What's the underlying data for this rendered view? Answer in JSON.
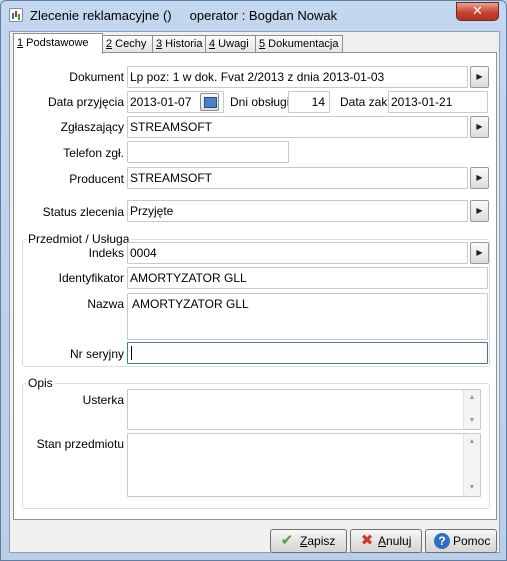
{
  "window": {
    "title": "Zlecenie reklamacyjne ()     operator : Bogdan Nowak",
    "close_label": "✕"
  },
  "tabs": [
    {
      "num": "1",
      "label": " Podstawowe"
    },
    {
      "num": "2",
      "label": " Cechy"
    },
    {
      "num": "3",
      "label": " Historia"
    },
    {
      "num": "4",
      "label": " Uwagi"
    },
    {
      "num": "5",
      "label": " Dokumentacja"
    }
  ],
  "form": {
    "dokument_label": "Dokument",
    "dokument_value": "Lp poz: 1  w dok.  Fvat 2/2013   z dnia 2013-01-03",
    "data_przyjecia_label": "Data przyjęcia",
    "data_przyjecia_value": "2013-01-07",
    "dni_obslugi_label": "Dni obsługi",
    "dni_obslugi_value": "14",
    "data_zak_label": "Data zak.",
    "data_zak_value": "2013-01-21",
    "zglaszajacy_label": "Zgłaszający",
    "zglaszajacy_value": "STREAMSOFT",
    "telefon_label": "Telefon zgł.",
    "telefon_value": "",
    "producent_label": "Producent",
    "producent_value": "STREAMSOFT",
    "status_label": "Status zlecenia",
    "status_value": "Przyjęte"
  },
  "przedmiot": {
    "group_title": "Przedmiot / Usługa",
    "indeks_label": "Indeks",
    "indeks_value": "0004",
    "identyfikator_label": "Identyfikator",
    "identyfikator_value": "AMORTYZATOR GLL",
    "nazwa_label": "Nazwa",
    "nazwa_value": "AMORTYZATOR GLL",
    "nr_seryjny_label": "Nr seryjny",
    "nr_seryjny_value": ""
  },
  "opis": {
    "group_title": "Opis",
    "usterka_label": "Usterka",
    "usterka_value": "",
    "stan_label": "Stan przedmiotu",
    "stan_value": ""
  },
  "buttons": {
    "zapisz_mnemonic": "Z",
    "zapisz_rest": "apisz",
    "anuluj_mnemonic": "A",
    "anuluj_rest": "nuluj",
    "pomoc_label": "Pomoc"
  },
  "icons": {
    "lookup": "arrow-right-icon",
    "calendar": "calendar-icon",
    "save": "checkmark-icon",
    "cancel": "x-icon",
    "help": "question-icon"
  },
  "colors": {
    "save_icon": "#4aa52e",
    "cancel_icon": "#d2372a",
    "help_icon": "#2f6fc1",
    "close_button": "#c7432f"
  }
}
